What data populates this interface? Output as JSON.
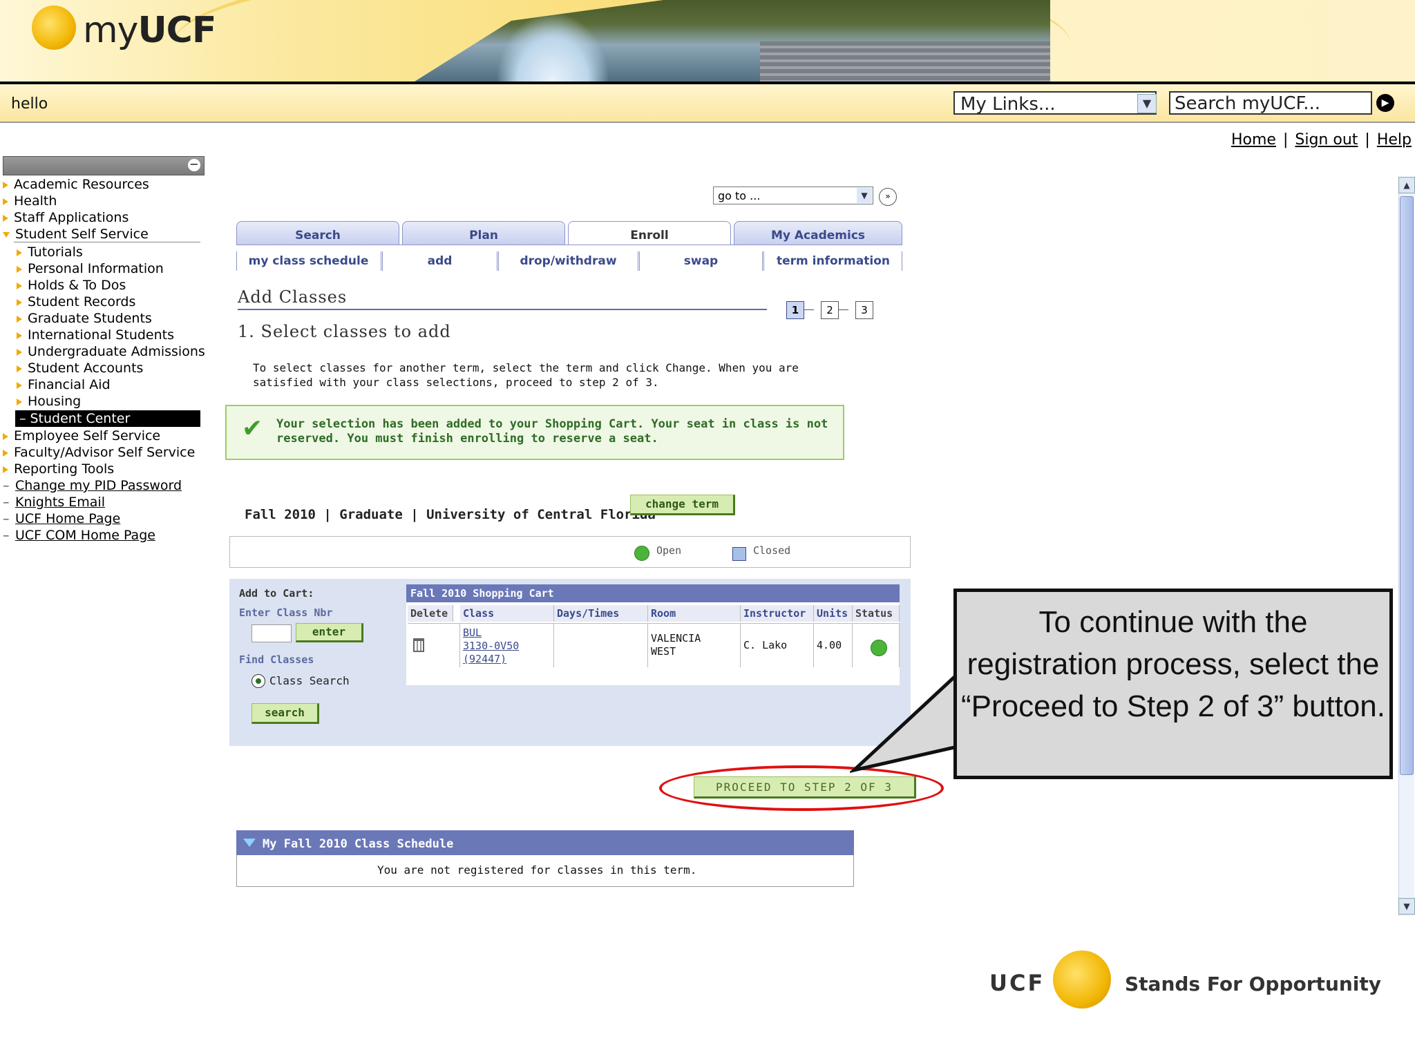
{
  "header": {
    "logo_text_my": "my",
    "logo_text_ucf": "UCF",
    "greeting": "hello",
    "my_links_value": "My Links...",
    "search_placeholder": "Search myUCF...",
    "top_links": [
      "Home",
      "Sign out",
      "Help"
    ]
  },
  "sidebar": {
    "items": [
      {
        "label": "Academic Resources",
        "kind": "folder"
      },
      {
        "label": "Health",
        "kind": "folder"
      },
      {
        "label": "Staff Applications",
        "kind": "folder"
      },
      {
        "label": "Student Self Service",
        "kind": "folder-open"
      },
      {
        "label": "Tutorials",
        "kind": "folder"
      },
      {
        "label": "Personal Information",
        "kind": "folder"
      },
      {
        "label": "Holds & To Dos",
        "kind": "folder"
      },
      {
        "label": "Student Records",
        "kind": "folder"
      },
      {
        "label": "Graduate Students",
        "kind": "folder"
      },
      {
        "label": "International Students",
        "kind": "folder"
      },
      {
        "label": "Undergraduate Admissions",
        "kind": "folder"
      },
      {
        "label": "Student Accounts",
        "kind": "folder"
      },
      {
        "label": "Financial Aid",
        "kind": "folder"
      },
      {
        "label": "Housing",
        "kind": "folder"
      },
      {
        "label": "Student Center",
        "kind": "selected"
      },
      {
        "label": "Employee Self Service",
        "kind": "folder"
      },
      {
        "label": "Faculty/Advisor Self Service",
        "kind": "folder"
      },
      {
        "label": "Reporting Tools",
        "kind": "folder"
      },
      {
        "label": "Change my PID Password",
        "kind": "link"
      },
      {
        "label": "Knights Email",
        "kind": "link"
      },
      {
        "label": "UCF Home Page",
        "kind": "link"
      },
      {
        "label": "UCF COM Home Page",
        "kind": "link"
      }
    ]
  },
  "main": {
    "goto_value": "go to ...",
    "tabs": [
      {
        "label": "Search",
        "active": false
      },
      {
        "label": "Plan",
        "active": false
      },
      {
        "label": "Enroll",
        "active": true
      },
      {
        "label": "My Academics",
        "active": false
      }
    ],
    "subtabs": [
      "my class schedule",
      "add",
      "drop/withdraw",
      "swap",
      "term information"
    ],
    "page_title": "Add Classes",
    "steps": [
      "1",
      "2",
      "3"
    ],
    "current_step": 1,
    "step_title": "1.  Select classes to add",
    "instructions": "To select classes for another term, select the term and click Change.  When you are satisfied with your class selections, proceed to step 2 of 3.",
    "success_message": "Your selection has been added to your Shopping Cart.  Your seat in class is not reserved. You must finish enrolling to reserve a seat.",
    "term_line": "Fall 2010 | Graduate | University of Central Florida",
    "change_term_label": "change term",
    "legend_open": "Open",
    "legend_closed": "Closed",
    "add_to_cart_label": "Add to Cart:",
    "enter_class_nbr_label": "Enter Class Nbr",
    "enter_button": "enter",
    "find_classes_label": "Find Classes",
    "class_search_label": "Class Search",
    "search_button": "search",
    "cart": {
      "title": "Fall 2010 Shopping Cart",
      "columns": [
        "Delete",
        "Class",
        "Days/Times",
        "Room",
        "Instructor",
        "Units",
        "Status"
      ],
      "rows": [
        {
          "class_l1": "BUL",
          "class_l2": "3130-0V50",
          "class_l3": "(92447)",
          "days_times": "",
          "room_l1": "VALENCIA",
          "room_l2": "WEST",
          "instructor": "C. Lako",
          "units": "4.00",
          "status": "open"
        }
      ]
    },
    "proceed_button": "PROCEED TO STEP 2 OF 3",
    "schedule_title": "My Fall 2010 Class Schedule",
    "schedule_message": "You are not registered for classes in this term."
  },
  "callout": {
    "text": "To continue with the registration process, select the “Proceed to Step 2 of 3” button."
  },
  "footer": {
    "ucf": "UCF",
    "slogan": "Stands For Opportunity"
  },
  "colors": {
    "accent_gold": "#f2b705",
    "tab_blue": "#3a4a8a",
    "success_green": "#3d9e2a",
    "highlight_red": "#e01010"
  }
}
